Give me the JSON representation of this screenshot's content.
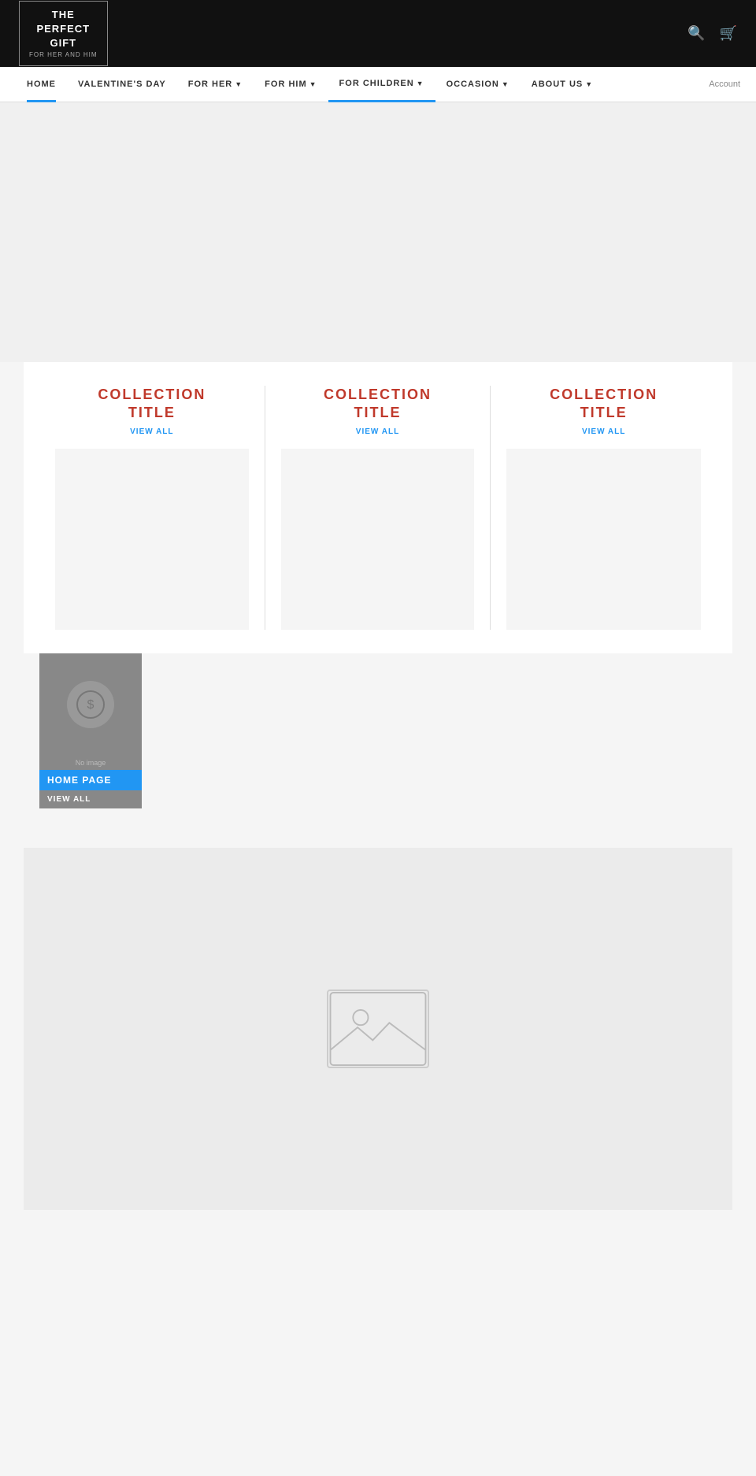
{
  "header": {
    "logo": {
      "line1": "THE",
      "line2": "PERFECT",
      "line3": "GIFT",
      "tagline": "FOR HER AND HIM"
    },
    "search_label": "Search",
    "cart_label": "Cart"
  },
  "nav": {
    "items": [
      {
        "label": "HOME",
        "active": true,
        "has_dropdown": false
      },
      {
        "label": "VALENTINE'S DAY",
        "active": false,
        "has_dropdown": false
      },
      {
        "label": "FOR HER",
        "active": false,
        "has_dropdown": true
      },
      {
        "label": "FOR HIM",
        "active": false,
        "has_dropdown": true
      },
      {
        "label": "FOR CHILDREN",
        "active": false,
        "has_dropdown": true,
        "highlighted": true
      },
      {
        "label": "OCCASION",
        "active": false,
        "has_dropdown": true
      },
      {
        "label": "ABOUT US",
        "active": false,
        "has_dropdown": true
      }
    ],
    "account_label": "Account"
  },
  "collections": [
    {
      "title_line1": "COLLECTION",
      "title_line2": "TITLE",
      "view_all": "VIEW ALL"
    },
    {
      "title_line1": "COLLECTION",
      "title_line2": "TITLE",
      "view_all": "VIEW ALL"
    },
    {
      "title_line1": "COLLECTION",
      "title_line2": "TITLE",
      "view_all": "VIEW ALL"
    }
  ],
  "no_image_card": {
    "no_image_text": "No image",
    "badge": "HOME PAGE",
    "view_all": "VIEW ALL"
  }
}
